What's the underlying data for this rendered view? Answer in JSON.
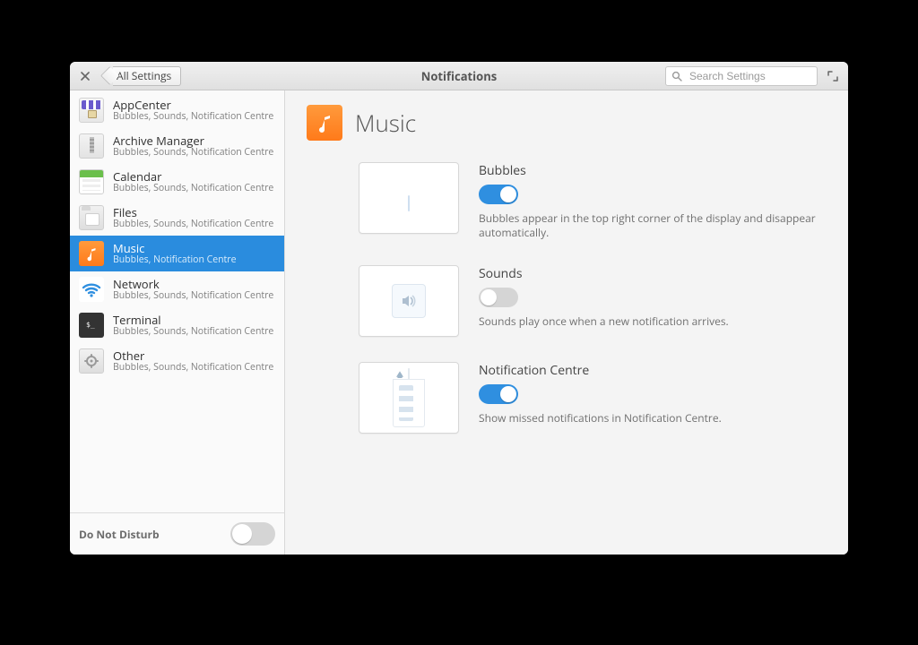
{
  "titlebar": {
    "breadcrumb_label": "All Settings",
    "title": "Notifications",
    "search_placeholder": "Search Settings"
  },
  "sidebar": {
    "items": [
      {
        "name": "AppCenter",
        "sub": "Bubbles, Sounds, Notification Centre",
        "icon": "appcenter"
      },
      {
        "name": "Archive Manager",
        "sub": "Bubbles, Sounds, Notification Centre",
        "icon": "archive"
      },
      {
        "name": "Calendar",
        "sub": "Bubbles, Sounds, Notification Centre",
        "icon": "calendar"
      },
      {
        "name": "Files",
        "sub": "Bubbles, Sounds, Notification Centre",
        "icon": "files"
      },
      {
        "name": "Music",
        "sub": "Bubbles, Notification Centre",
        "icon": "music",
        "selected": true
      },
      {
        "name": "Network",
        "sub": "Bubbles, Sounds, Notification Centre",
        "icon": "network"
      },
      {
        "name": "Terminal",
        "sub": "Bubbles, Sounds, Notification Centre",
        "icon": "terminal"
      },
      {
        "name": "Other",
        "sub": "Bubbles, Sounds, Notification Centre",
        "icon": "other"
      }
    ],
    "dnd_label": "Do Not Disturb",
    "dnd_on": false
  },
  "content": {
    "app_name": "Music",
    "options": {
      "bubbles": {
        "title": "Bubbles",
        "desc": "Bubbles appear in the top right corner of the display and disappear automatically.",
        "on": true
      },
      "sounds": {
        "title": "Sounds",
        "desc": "Sounds play once when a new notification arrives.",
        "on": false
      },
      "notification_centre": {
        "title": "Notification Centre",
        "desc": "Show missed notifications in Notification Centre.",
        "on": true
      }
    }
  }
}
